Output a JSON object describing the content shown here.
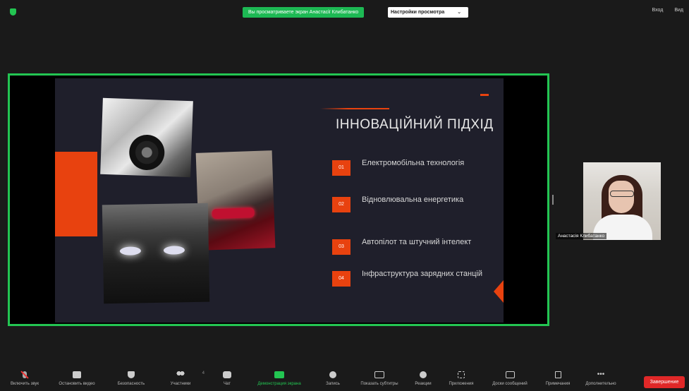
{
  "topbar": {
    "share_banner": "Вы просматриваете экран Анастасії Клибатанко",
    "view_options": "Настройки просмотра",
    "view_options_caret": "⌄",
    "right_items": [
      "Вход",
      "Вид"
    ]
  },
  "slide": {
    "title": "ІННОВАЦІЙНИЙ ПІДХІД",
    "items": [
      {
        "num": "01",
        "text": "Електромобільна технологія"
      },
      {
        "num": "02",
        "text": "Відновлювальна енергетика"
      },
      {
        "num": "03",
        "text": "Автопілот та штучний інтелект"
      },
      {
        "num": "04",
        "text": "Інфраструктура зарядних станцій"
      }
    ],
    "accent_color": "#e8420f"
  },
  "participant": {
    "name": "Анастасія Клибатанко"
  },
  "toolbar": {
    "buttons": [
      {
        "label": "Включить звук",
        "icon": "microphone-muted-icon"
      },
      {
        "label": "Остановить видео",
        "icon": "video-camera-icon"
      },
      {
        "label": "Безопасность",
        "icon": "shield-icon"
      },
      {
        "label": "Участники",
        "icon": "participants-icon",
        "count": "4"
      },
      {
        "label": "Чат",
        "icon": "chat-icon"
      },
      {
        "label": "Демонстрация экрана",
        "icon": "share-screen-icon"
      },
      {
        "label": "Запись",
        "icon": "record-icon"
      },
      {
        "label": "Показать субтитры",
        "icon": "captions-icon"
      },
      {
        "label": "Реакции",
        "icon": "reactions-icon"
      },
      {
        "label": "Приложения",
        "icon": "apps-icon"
      },
      {
        "label": "Доски сообщений",
        "icon": "whiteboard-icon"
      },
      {
        "label": "Примечания",
        "icon": "notes-icon"
      },
      {
        "label": "Дополнительно",
        "icon": "more-icon"
      }
    ],
    "end_label": "Завершение"
  },
  "colors": {
    "share_border": "#23c552",
    "end_button": "#e02828"
  }
}
